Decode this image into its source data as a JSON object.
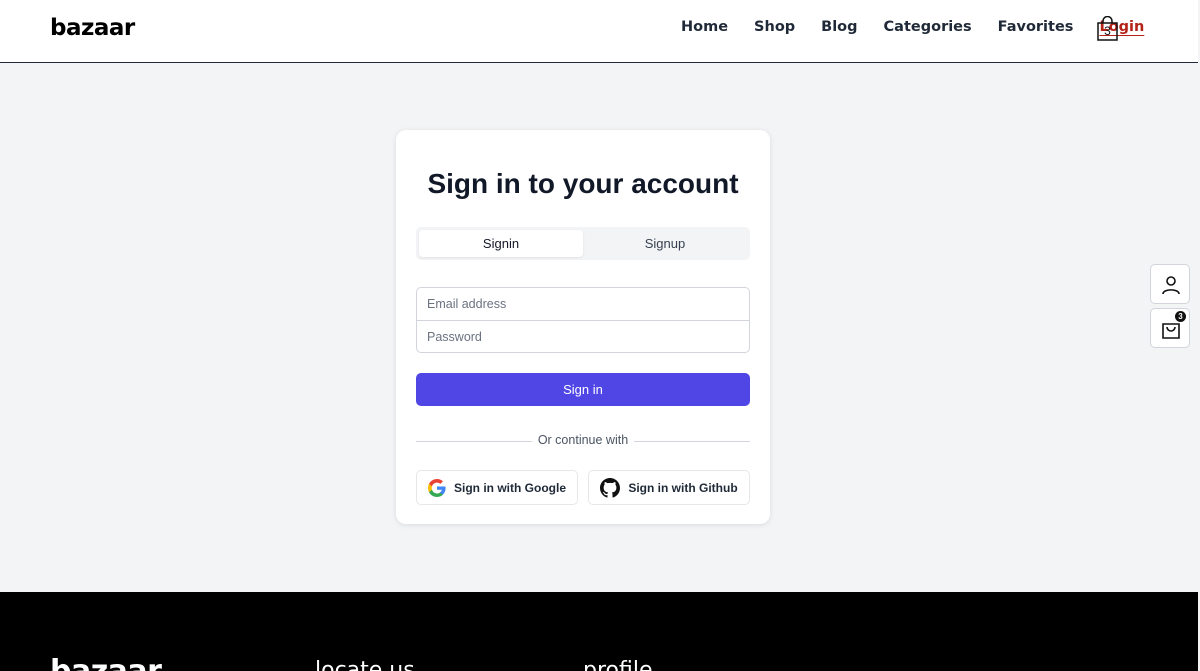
{
  "header": {
    "logo": "bazaar",
    "nav": [
      "Home",
      "Shop",
      "Blog",
      "Categories",
      "Favorites",
      "Login"
    ],
    "active_nav": "Login",
    "active_color": "#b42318",
    "cart_count": "3",
    "cart_icon": "shopping-bag-icon"
  },
  "card": {
    "title": "Sign in to your account",
    "tabs": {
      "signin": "Signin",
      "signup": "Signup"
    },
    "email_placeholder": "Email address",
    "password_placeholder": "Password",
    "signin_button": "Sign in",
    "divider_text": "Or continue with",
    "google_button": "Sign in with Google",
    "github_button": "Sign in with Github",
    "accent": "#4f46e5"
  },
  "side": {
    "user_icon": "user-icon",
    "bag_icon": "shopping-bag-icon",
    "bag_count": "3"
  },
  "footer": {
    "logo": "bazaar",
    "heading_1": "locate us",
    "heading_2": "profile"
  }
}
